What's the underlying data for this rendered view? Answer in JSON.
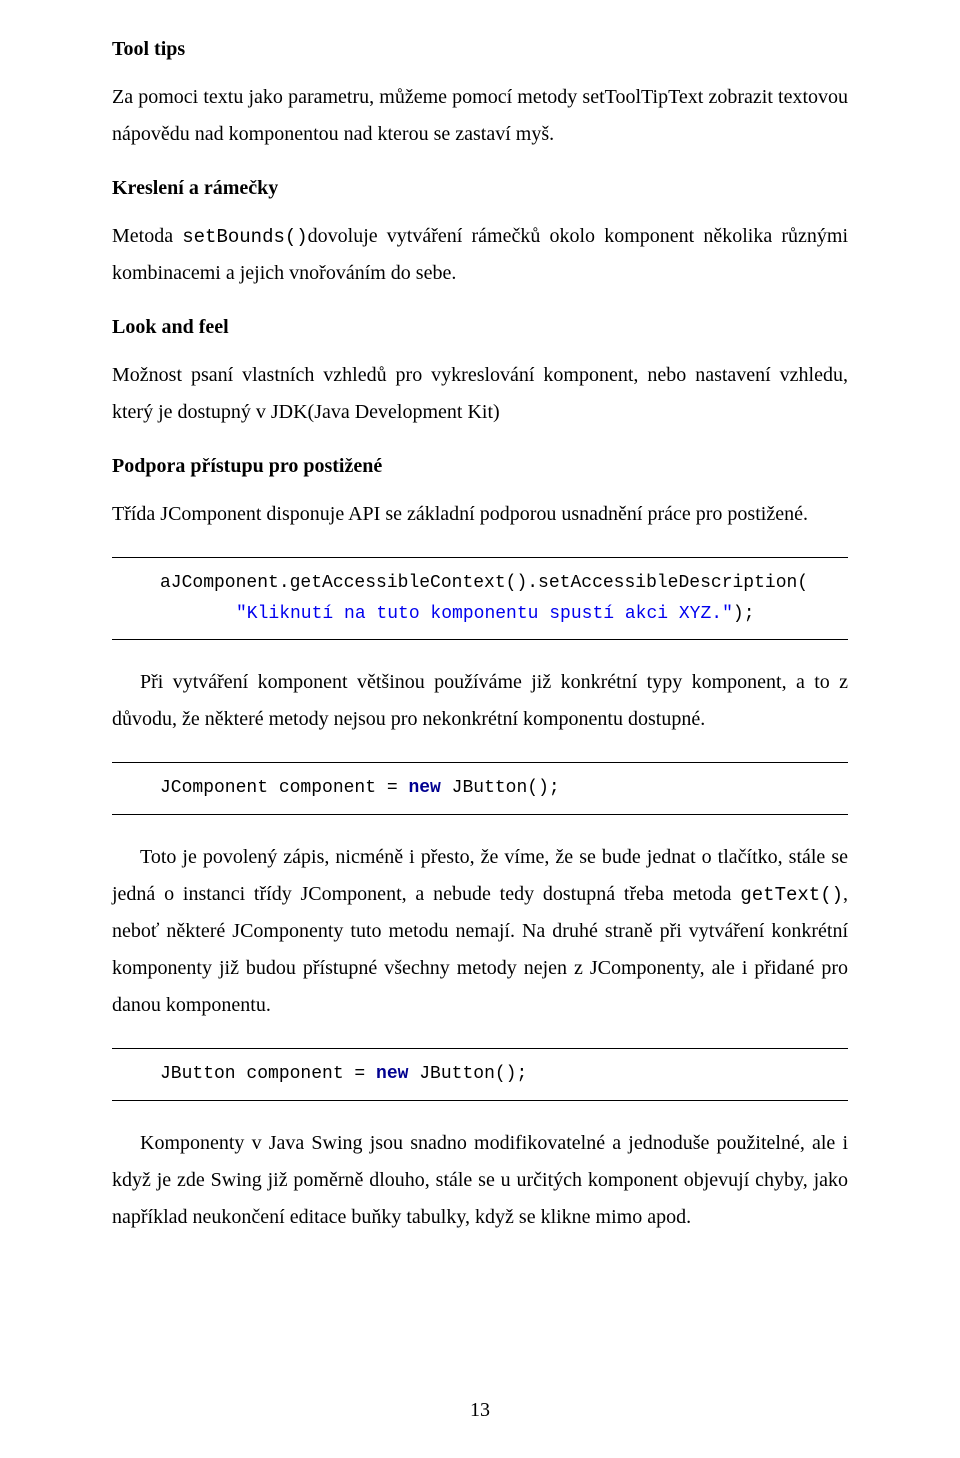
{
  "s1": {
    "head": "Tool tips",
    "para": "Za pomoci textu jako parametru, můžeme pomocí metody setToolTipText zobrazit textovou nápovědu nad komponentou nad kterou se zastaví myš."
  },
  "s2": {
    "head": "Kreslení a rámečky",
    "p_a": "Metoda ",
    "p_code": "setBounds()",
    "p_b": "dovoluje vytváření rámečků okolo komponent několika různými kombinacemi a jejich vnořováním do sebe."
  },
  "s3": {
    "head": "Look and feel",
    "para": "Možnost psaní vlastních vzhledů pro vykreslování komponent, nebo nastavení vzhledu, který je dostupný v JDK(Java Development Kit)"
  },
  "s4": {
    "head": "Podpora přístupu pro postižené",
    "para": "Třída JComponent disponuje API se základní podporou usnadnění práce pro postižené."
  },
  "code1": {
    "l1": "aJComponent.getAccessibleContext().setAccessibleDescription(",
    "l2_str": "\"Kliknutí na tuto komponentu spustí akci XYZ.\"",
    "l2_tail": ");"
  },
  "p5": "Při vytváření komponent většinou používáme již konkrétní typy komponent, a to z důvodu, že některé metody nejsou pro nekonkrétní komponentu dostupné.",
  "code2": {
    "l1a": "JComponent component = ",
    "l1kw": "new",
    "l1b": " JButton();"
  },
  "p6": {
    "a": "Toto je povolený zápis, nicméně i přesto, že víme, že se bude jednat o tlačítko, stále se jedná o instanci třídy JComponent, a nebude tedy dostupná třeba metoda ",
    "code": "getText()",
    "b": ", neboť některé JComponenty tuto metodu nemají. Na druhé straně při vytváření konkrétní komponenty již budou přístupné všechny metody nejen z JComponenty, ale i přidané pro danou komponentu."
  },
  "code3": {
    "l1a": "JButton component = ",
    "l1kw": "new",
    "l1b": " JButton();"
  },
  "p7": "Komponenty v Java Swing jsou snadno modifikovatelné a jednoduše použitelné, ale i když je zde Swing již poměrně dlouho, stále se u určitých komponent objevují chyby, jako například neukončení editace buňky tabulky, když se klikne mimo apod.",
  "pagenum": "13"
}
